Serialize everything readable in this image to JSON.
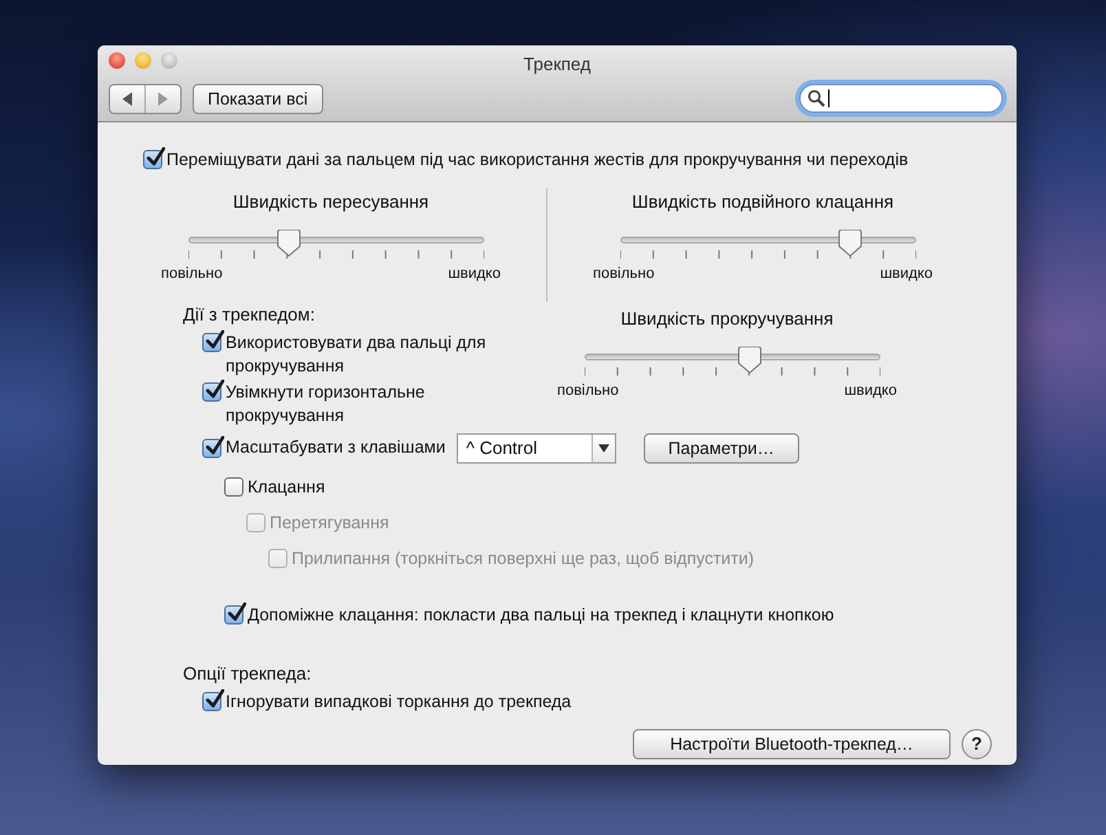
{
  "window": {
    "title": "Трекпед"
  },
  "toolbar": {
    "show_all_button": "Показати всі"
  },
  "top_option": {
    "label": "Переміщувати дані за пальцем під час використання жестів для прокручування чи переходів",
    "checked": true
  },
  "sliders": [
    {
      "title": "Швидкість пересування",
      "level": 0.34,
      "min_label": "повільно",
      "max_label": "швидко"
    },
    {
      "title": "Швидкість подвійного клацання",
      "level": 0.78,
      "min_label": "повільно",
      "max_label": "швидко"
    }
  ],
  "trackpad_actions": {
    "heading": "Дії з трекпедом:",
    "scroll_slider": {
      "title": "Швидкість прокручування",
      "level": 0.56,
      "min_label": "повільно",
      "max_label": "швидко"
    },
    "items": [
      {
        "label": "Використовувати два пальці для прокручування",
        "checked": true,
        "disabled": false
      },
      {
        "label": "Увімкнути горизонтальне прокручування",
        "checked": true,
        "disabled": false
      },
      {
        "label": "Масштабувати з клавішами",
        "checked": true,
        "disabled": false,
        "popup": "^ Control",
        "button": "Параметри…",
        "children": [
          {
            "label": "Клацання",
            "checked": false,
            "disabled": false,
            "children": [
              {
                "label": "Перетягування",
                "checked": false,
                "disabled": true,
                "children": [
                  {
                    "label": "Прилипання (торкніться поверхні ще раз, щоб відпустити)",
                    "checked": false,
                    "disabled": true
                  }
                ]
              }
            ]
          },
          {
            "label": "Допоміжне клацання: покласти два пальці на трекпед і клацнути кнопкою",
            "checked": true,
            "disabled": false
          }
        ]
      }
    ]
  },
  "trackpad_options": {
    "heading": "Опції трекпеда:",
    "items": [
      {
        "label": "Ігнорувати випадкові торкання до трекпеда",
        "checked": true,
        "disabled": false
      }
    ]
  },
  "footer": {
    "bluetooth_button": "Настроїти Bluetooth-трекпед…",
    "help_button": "?"
  }
}
